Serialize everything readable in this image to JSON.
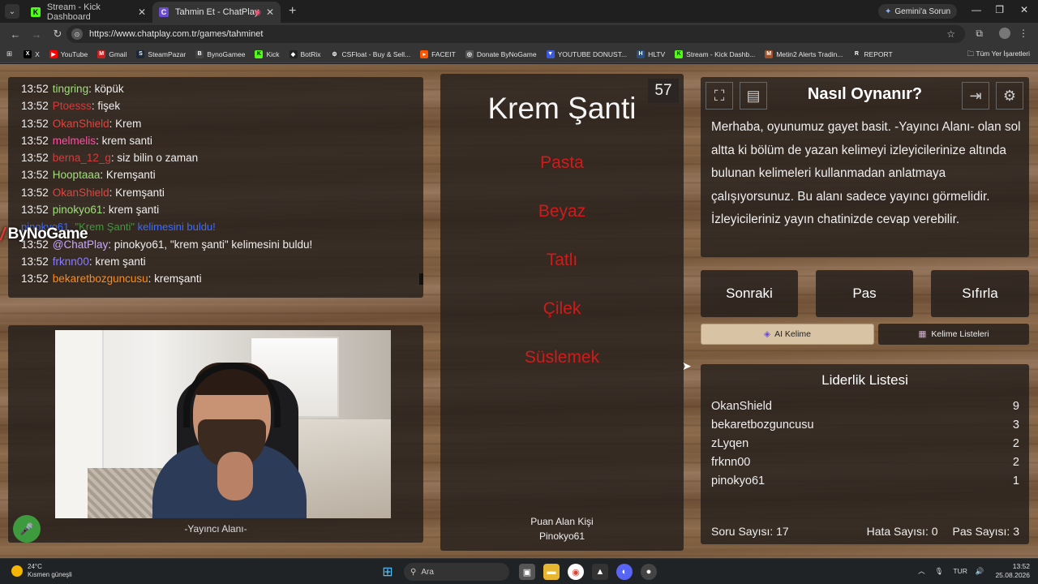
{
  "browser": {
    "tabs": [
      {
        "label": "Stream - Kick Dashboard",
        "active": false
      },
      {
        "label": "Tahmin Et - ChatPlay",
        "active": true
      }
    ],
    "gemini_label": "Gemini'a Sorun",
    "url": "https://www.chatplay.com.tr/games/tahminet",
    "bookmarks": [
      "X",
      "YouTube",
      "Gmail",
      "SteamPazar",
      "BynoGamee",
      "Kick",
      "BotRix",
      "CSFloat - Buy & Sell...",
      "FACEIT",
      "Donate ByNoGame",
      "YOUTUBE DONUST...",
      "HLTV",
      "Stream - Kick Dashb...",
      "Metin2 Alerts Tradin...",
      "REPORT"
    ],
    "all_bookmarks": "Tüm Yer İşaretleri"
  },
  "chat": {
    "messages": [
      {
        "time": "13:52",
        "user": "tingring",
        "color": "#9ee07a",
        "text": ": köpük"
      },
      {
        "time": "13:52",
        "user": "Ptoesss",
        "color": "#d33b3b",
        "text": ": fişek"
      },
      {
        "time": "13:52",
        "user": "OkanShield",
        "color": "#e0443e",
        "text": ": Krem"
      },
      {
        "time": "13:52",
        "user": "melmelis",
        "color": "#ff4fa3",
        "text": ": krem santi"
      },
      {
        "time": "13:52",
        "user": "berna_12_g",
        "color": "#d33b3b",
        "text": ": siz bilin o zaman"
      },
      {
        "time": "13:52",
        "user": "Hooptaaa",
        "color": "#9ee07a",
        "text": ": Kremşanti"
      },
      {
        "time": "13:52",
        "user": "OkanShield",
        "color": "#e0443e",
        "text": ": Kremşanti"
      },
      {
        "time": "13:52",
        "user": "pinokyo61",
        "color": "#9ee07a",
        "text": ": krem şanti"
      }
    ],
    "system_found": {
      "user": "pinokyo61,",
      "quote": "\"Krem Şanti\"",
      "tail": "kelimesini buldu!"
    },
    "messages2": [
      {
        "time": "13:52",
        "user": "@ChatPlay",
        "color": "#c9a7ff",
        "text": ": pinokyo61, \"krem şanti\" kelimesini buldu!"
      },
      {
        "time": "13:52",
        "user": "frknn00",
        "color": "#8a7dff",
        "text": ": krem şanti"
      },
      {
        "time": "13:52",
        "user": "bekaretbozguncusu",
        "color": "#ff8c1a",
        "text": ": kremşanti"
      }
    ]
  },
  "overlay_logo": "ByNoGame",
  "streamer_label": "-Yayıncı Alanı-",
  "game": {
    "word": "Krem Şanti",
    "counter": "57",
    "forbidden": [
      "Pasta",
      "Beyaz",
      "Tatlı",
      "Çilek",
      "Süslemek"
    ],
    "scorer_title": "Puan Alan Kişi",
    "scorer_name": "Pinokyo61"
  },
  "help": {
    "title": "Nasıl Oynanır?",
    "text": "Merhaba, oyunumuz gayet basit. -Yayıncı Alanı- olan sol altta ki bölüm de yazan kelimeyi izleyicilerinize altında bulunan kelimeleri kullanmadan anlatmaya çalışıyorsunuz. Bu alanı sadece yayıncı görmelidir. İzleyicileriniz yayın chatinizde cevap verebilir."
  },
  "actions": {
    "next": "Sonraki",
    "pass": "Pas",
    "reset": "Sıfırla",
    "ai": "AI Kelime",
    "lists": "Kelime Listeleri"
  },
  "leaderboard": {
    "title": "Liderlik Listesi",
    "rows": [
      {
        "name": "OkanShield",
        "score": "9"
      },
      {
        "name": "bekaretbozguncusu",
        "score": "3"
      },
      {
        "name": "zLyqen",
        "score": "2"
      },
      {
        "name": "frknn00",
        "score": "2"
      },
      {
        "name": "pinokyo61",
        "score": "1"
      }
    ],
    "questions": "Soru Sayısı: 17",
    "errors": "Hata Sayısı: 0",
    "passes": "Pas Sayısı: 3"
  },
  "taskbar": {
    "temp": "24°C",
    "weather": "Kısmen güneşli",
    "search": "Ara",
    "lang": "TUR",
    "time": "13:52",
    "date": "25.08.2026"
  },
  "colors": {
    "taboo_red": "#d11b1b",
    "panel": "#26201c",
    "system_blue": "#3b6cff"
  }
}
